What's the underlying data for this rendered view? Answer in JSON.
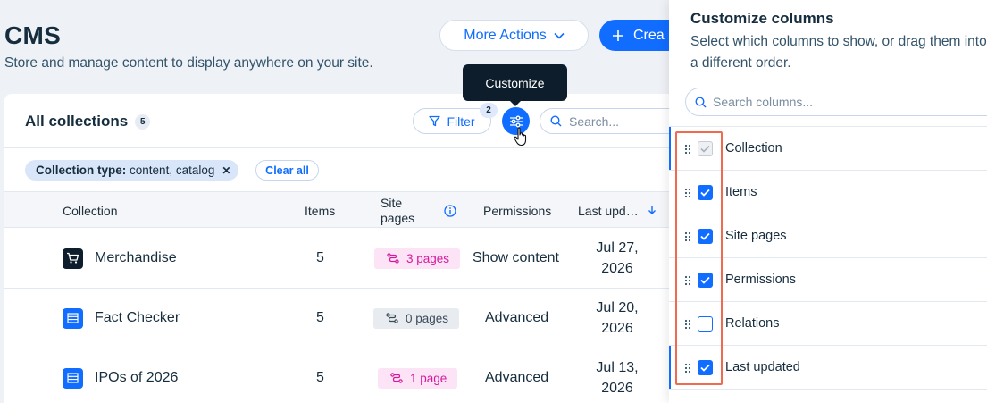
{
  "header": {
    "title": "CMS",
    "subtitle": "Store and manage content to display anywhere on your site.",
    "more_actions_label": "More Actions",
    "create_label": "Crea"
  },
  "tooltip": {
    "text": "Customize"
  },
  "collections": {
    "title": "All collections",
    "count": "5",
    "filter_label": "Filter",
    "filter_count": "2",
    "search_placeholder": "Search...",
    "chip": {
      "key": "Collection type:",
      "value": "content, catalog"
    },
    "clear_all_label": "Clear all",
    "columns": {
      "collection": "Collection",
      "items": "Items",
      "site_pages": "Site pages",
      "permissions": "Permissions",
      "last_updated": "Last upd…"
    },
    "rows": [
      {
        "name": "Merchandise",
        "icon": "cart-icon",
        "items": "5",
        "pages": "3 pages",
        "pages_style": "pink",
        "permissions": "Show content",
        "date1": "Jul 27,",
        "date2": "2026"
      },
      {
        "name": "Fact Checker",
        "icon": "table-icon",
        "items": "5",
        "pages": "0 pages",
        "pages_style": "gray",
        "permissions": "Advanced",
        "date1": "Jul 20,",
        "date2": "2026"
      },
      {
        "name": "IPOs of 2026",
        "icon": "table-icon",
        "items": "5",
        "pages": "1 page",
        "pages_style": "pink",
        "permissions": "Advanced",
        "date1": "Jul 13,",
        "date2": "2026"
      }
    ]
  },
  "panel": {
    "title": "Customize columns",
    "subtitle": "Select which columns to show, or drag them into a different order.",
    "search_placeholder": "Search columns...",
    "items": [
      {
        "label": "Collection",
        "state": "disabled-checked"
      },
      {
        "label": "Items",
        "state": "checked"
      },
      {
        "label": "Site pages",
        "state": "checked"
      },
      {
        "label": "Permissions",
        "state": "checked"
      },
      {
        "label": "Relations",
        "state": "unchecked"
      },
      {
        "label": "Last updated",
        "state": "checked"
      }
    ]
  },
  "colors": {
    "accent": "#116dff",
    "highlight": "#ef6a4f",
    "pink_pill_text": "#d5199d",
    "pink_pill_bg": "#fde3f6"
  }
}
